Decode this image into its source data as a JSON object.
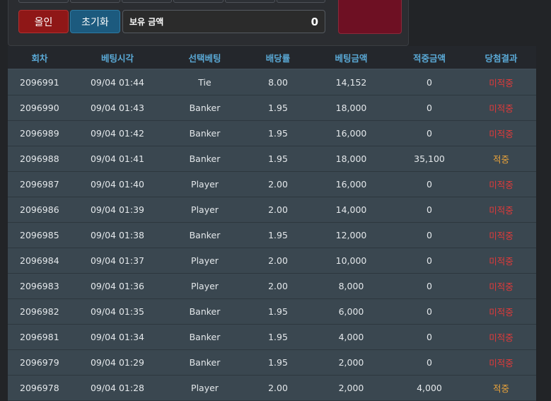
{
  "controls": {
    "allin_label": "올인",
    "reset_label": "초기화",
    "balance_label": "보유 금액",
    "balance_value": "0"
  },
  "colors": {
    "header_text": "#5aa9d6",
    "miss": "#e03a3a",
    "hit": "#e8a23a",
    "allin_button": "#8f1717",
    "reset_button": "#1c5a7e",
    "bet_panel": "#6e1023"
  },
  "table": {
    "headers": [
      "회차",
      "베팅시각",
      "선택베팅",
      "배당률",
      "베팅금액",
      "적중금액",
      "당첨결과"
    ],
    "rows": [
      {
        "round": "2096991",
        "time": "09/04 01:44",
        "choice": "Tie",
        "odds": "8.00",
        "bet": "14,152",
        "win": "0",
        "result": "미적중",
        "status": "miss"
      },
      {
        "round": "2096990",
        "time": "09/04 01:43",
        "choice": "Banker",
        "odds": "1.95",
        "bet": "18,000",
        "win": "0",
        "result": "미적중",
        "status": "miss"
      },
      {
        "round": "2096989",
        "time": "09/04 01:42",
        "choice": "Banker",
        "odds": "1.95",
        "bet": "16,000",
        "win": "0",
        "result": "미적중",
        "status": "miss"
      },
      {
        "round": "2096988",
        "time": "09/04 01:41",
        "choice": "Banker",
        "odds": "1.95",
        "bet": "18,000",
        "win": "35,100",
        "result": "적중",
        "status": "hit"
      },
      {
        "round": "2096987",
        "time": "09/04 01:40",
        "choice": "Player",
        "odds": "2.00",
        "bet": "16,000",
        "win": "0",
        "result": "미적중",
        "status": "miss"
      },
      {
        "round": "2096986",
        "time": "09/04 01:39",
        "choice": "Player",
        "odds": "2.00",
        "bet": "14,000",
        "win": "0",
        "result": "미적중",
        "status": "miss"
      },
      {
        "round": "2096985",
        "time": "09/04 01:38",
        "choice": "Banker",
        "odds": "1.95",
        "bet": "12,000",
        "win": "0",
        "result": "미적중",
        "status": "miss"
      },
      {
        "round": "2096984",
        "time": "09/04 01:37",
        "choice": "Player",
        "odds": "2.00",
        "bet": "10,000",
        "win": "0",
        "result": "미적중",
        "status": "miss"
      },
      {
        "round": "2096983",
        "time": "09/04 01:36",
        "choice": "Player",
        "odds": "2.00",
        "bet": "8,000",
        "win": "0",
        "result": "미적중",
        "status": "miss"
      },
      {
        "round": "2096982",
        "time": "09/04 01:35",
        "choice": "Banker",
        "odds": "1.95",
        "bet": "6,000",
        "win": "0",
        "result": "미적중",
        "status": "miss"
      },
      {
        "round": "2096981",
        "time": "09/04 01:34",
        "choice": "Banker",
        "odds": "1.95",
        "bet": "4,000",
        "win": "0",
        "result": "미적중",
        "status": "miss"
      },
      {
        "round": "2096979",
        "time": "09/04 01:29",
        "choice": "Banker",
        "odds": "1.95",
        "bet": "2,000",
        "win": "0",
        "result": "미적중",
        "status": "miss"
      },
      {
        "round": "2096978",
        "time": "09/04 01:28",
        "choice": "Player",
        "odds": "2.00",
        "bet": "2,000",
        "win": "4,000",
        "result": "적중",
        "status": "hit"
      }
    ]
  }
}
